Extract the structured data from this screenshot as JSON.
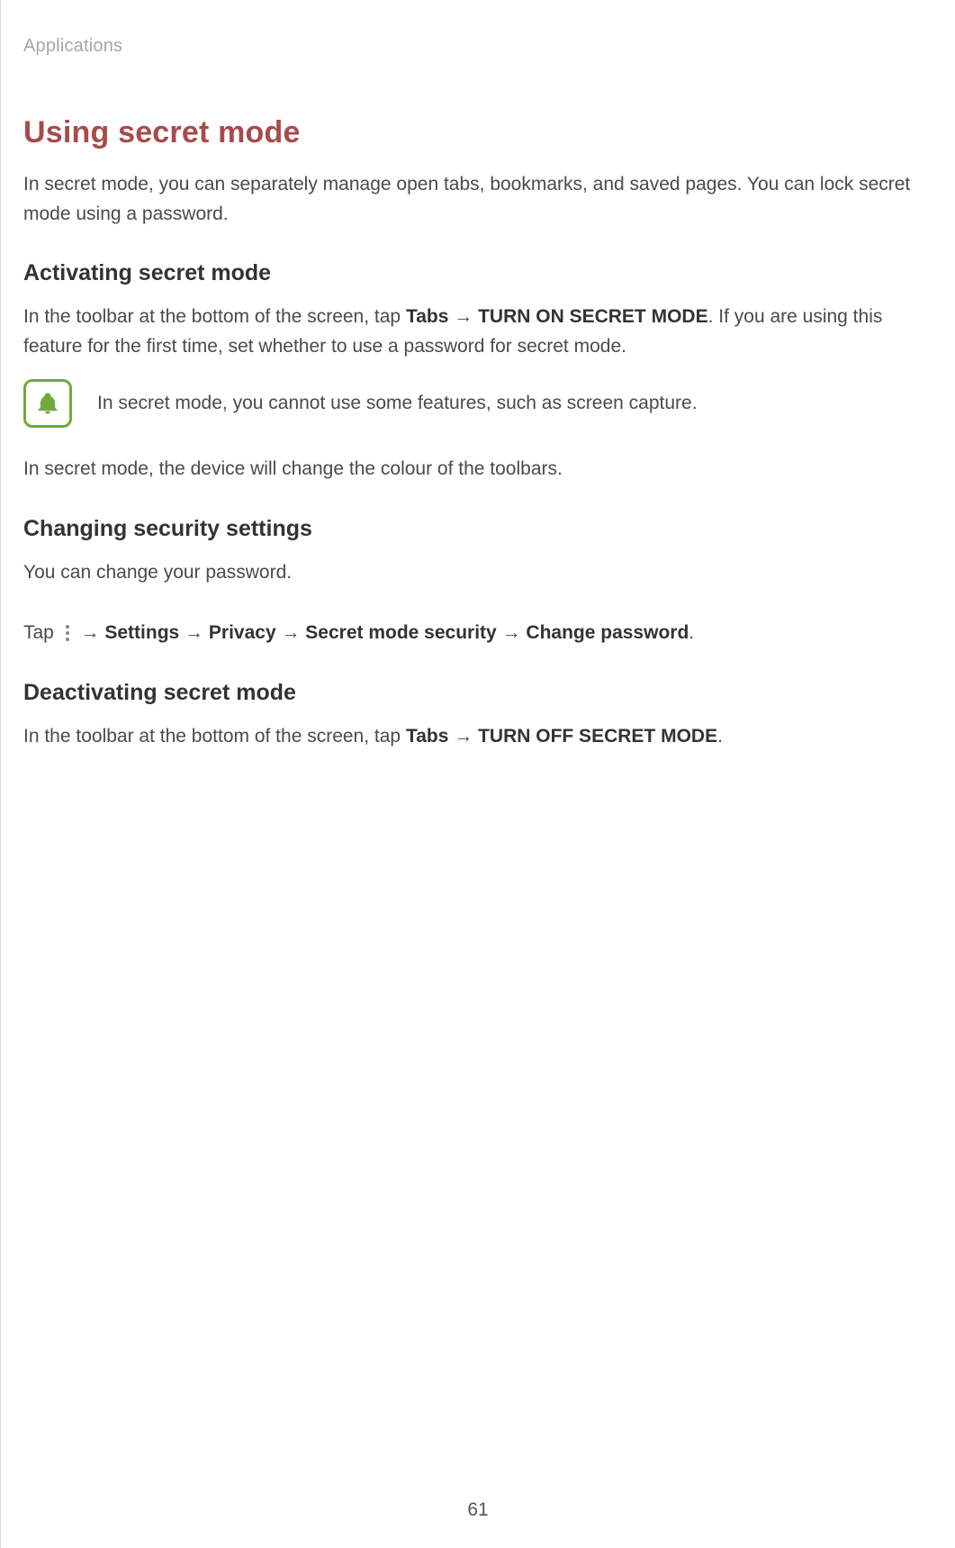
{
  "header": {
    "section_label": "Applications"
  },
  "title": "Using secret mode",
  "intro": "In secret mode, you can separately manage open tabs, bookmarks, and saved pages. You can lock secret mode using a password.",
  "sections": {
    "activating": {
      "heading": "Activating secret mode",
      "para_prefix": "In the toolbar at the bottom of the screen, tap ",
      "tabs_label": "Tabs",
      "arrow": " → ",
      "turn_on_label": "TURN ON SECRET MODE",
      "para_suffix": ". If you are using this feature for the first time, set whether to use a password for secret mode.",
      "note": "In secret mode, you cannot use some features, such as screen capture.",
      "after_note": "In secret mode, the device will change the colour of the toolbars."
    },
    "changing": {
      "heading": "Changing security settings",
      "line1": "You can change your password.",
      "tap_prefix": "Tap ",
      "arrow": " → ",
      "settings": "Settings",
      "privacy": "Privacy",
      "secret_mode_security": "Secret mode security",
      "change_password": "Change password",
      "period": "."
    },
    "deactivating": {
      "heading": "Deactivating secret mode",
      "para_prefix": "In the toolbar at the bottom of the screen, tap ",
      "tabs_label": "Tabs",
      "arrow": " → ",
      "turn_off_label": "TURN OFF SECRET MODE",
      "period": "."
    }
  },
  "page_number": "61"
}
